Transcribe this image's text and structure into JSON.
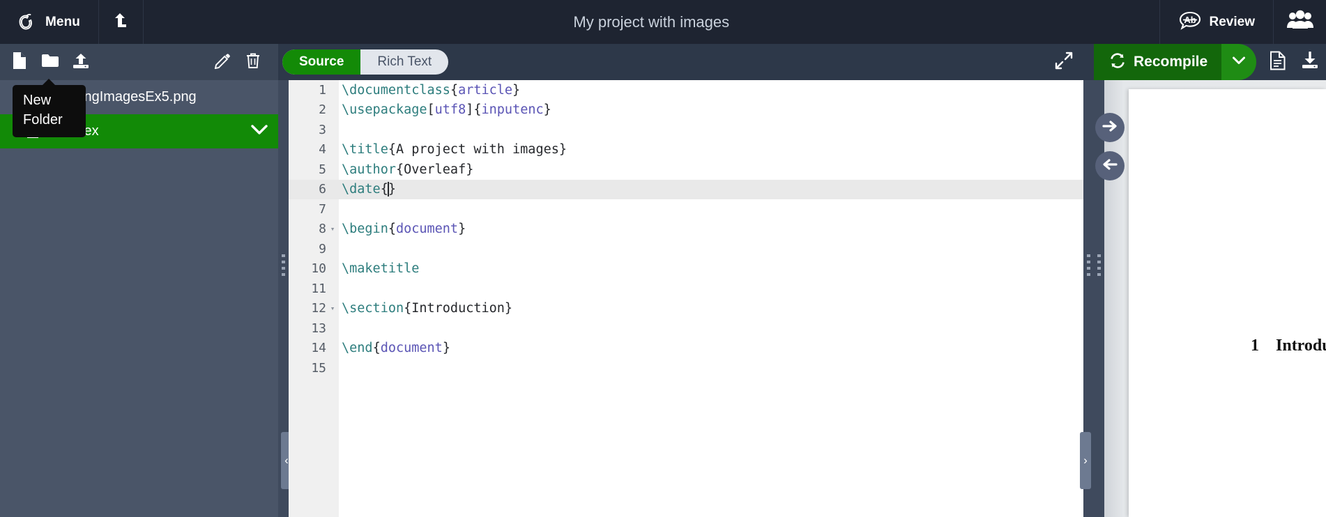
{
  "header": {
    "logo_icon": "overleaf-logo-icon",
    "menu_label": "Menu",
    "upload_icon": "upload-arrow-icon",
    "project_title": "My project with images",
    "review_icon": "review-speech-bubble-ab-icon",
    "review_label": "Review",
    "people_icon": "share-people-icon"
  },
  "file_toolbar": {
    "new_file_icon": "new-file-icon",
    "new_folder_icon": "new-folder-icon",
    "upload_icon": "upload-file-icon",
    "rename_icon": "pencil-edit-icon",
    "delete_icon": "trash-delete-icon"
  },
  "tooltip": {
    "text": "New Folder"
  },
  "file_tree": {
    "items": [
      {
        "name": "InsertingImagesEx5.png",
        "icon": "image-file-icon",
        "selected": false
      },
      {
        "name": "main.tex",
        "icon": "tex-file-icon",
        "selected": true,
        "chevron": "chevron-down-icon"
      }
    ]
  },
  "editor_toolbar": {
    "mode_source": "Source",
    "mode_rich_text": "Rich Text",
    "active_mode": "Source",
    "expand_icon": "expand-fullscreen-icon"
  },
  "pdf_toolbar": {
    "recompile_icon": "recompile-refresh-icon",
    "recompile_label": "Recompile",
    "caret_icon": "chevron-down-icon",
    "logs_icon": "document-logs-icon",
    "download_icon": "download-pdf-icon"
  },
  "editor": {
    "active_line": 6,
    "collapse_left_icon": "chevron-left-icon",
    "collapse_right_icon": "chevron-right-icon",
    "lines": [
      {
        "n": "1",
        "fold": "",
        "tokens": [
          {
            "t": "\\documentclass",
            "c": "cmd"
          },
          {
            "t": "{",
            "c": "pun"
          },
          {
            "t": "article",
            "c": "kw"
          },
          {
            "t": "}",
            "c": "pun"
          }
        ]
      },
      {
        "n": "2",
        "fold": "",
        "tokens": [
          {
            "t": "\\usepackage",
            "c": "cmd"
          },
          {
            "t": "[",
            "c": "pun"
          },
          {
            "t": "utf8",
            "c": "kw"
          },
          {
            "t": "]{",
            "c": "pun"
          },
          {
            "t": "inputenc",
            "c": "kw"
          },
          {
            "t": "}",
            "c": "pun"
          }
        ]
      },
      {
        "n": "3",
        "fold": "",
        "tokens": []
      },
      {
        "n": "4",
        "fold": "",
        "tokens": [
          {
            "t": "\\title",
            "c": "cmd"
          },
          {
            "t": "{A project with images}",
            "c": "pun"
          }
        ]
      },
      {
        "n": "5",
        "fold": "",
        "tokens": [
          {
            "t": "\\author",
            "c": "cmd"
          },
          {
            "t": "{Overleaf}",
            "c": "pun"
          }
        ]
      },
      {
        "n": "6",
        "fold": "",
        "tokens": [
          {
            "t": "\\date",
            "c": "cmd"
          },
          {
            "t": "{",
            "c": "pun"
          },
          {
            "t": "CARET",
            "c": "caret"
          },
          {
            "t": "}",
            "c": "pun"
          }
        ]
      },
      {
        "n": "7",
        "fold": "",
        "tokens": []
      },
      {
        "n": "8",
        "fold": "▾",
        "tokens": [
          {
            "t": "\\begin",
            "c": "cmd"
          },
          {
            "t": "{",
            "c": "pun"
          },
          {
            "t": "document",
            "c": "kw"
          },
          {
            "t": "}",
            "c": "pun"
          }
        ]
      },
      {
        "n": "9",
        "fold": "",
        "tokens": []
      },
      {
        "n": "10",
        "fold": "",
        "tokens": [
          {
            "t": "\\maketitle",
            "c": "cmd"
          }
        ]
      },
      {
        "n": "11",
        "fold": "",
        "tokens": []
      },
      {
        "n": "12",
        "fold": "▾",
        "tokens": [
          {
            "t": "\\section",
            "c": "cmd"
          },
          {
            "t": "{Introduction}",
            "c": "pun"
          }
        ]
      },
      {
        "n": "13",
        "fold": "",
        "tokens": []
      },
      {
        "n": "14",
        "fold": "",
        "tokens": [
          {
            "t": "\\end",
            "c": "cmd"
          },
          {
            "t": "{",
            "c": "pun"
          },
          {
            "t": "document",
            "c": "kw"
          },
          {
            "t": "}",
            "c": "pun"
          }
        ]
      },
      {
        "n": "15",
        "fold": "",
        "tokens": []
      }
    ]
  },
  "pdf_preview": {
    "sync_to_pdf_icon": "arrow-right-sync-icon",
    "sync_to_code_icon": "arrow-left-sync-icon",
    "section_number": "1",
    "section_title": "Introduct"
  },
  "colors": {
    "header_bg": "#1e2431",
    "toolbar_bg": "#2d3849",
    "file_toolbar_bg": "#3a4556",
    "sidebar_bg": "#4a5568",
    "accent_green": "#138a07",
    "recompile_green": "#13670b",
    "splitter": "#3f4a5d",
    "code_cmd": "#2d7d7d",
    "code_kw": "#5b55b5",
    "code_text": "#26282c"
  }
}
